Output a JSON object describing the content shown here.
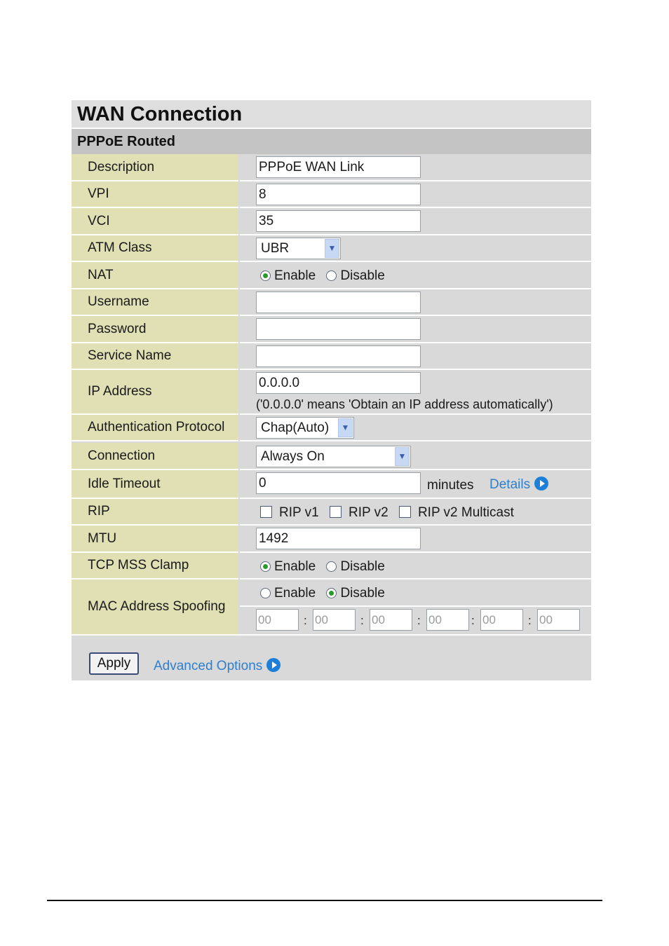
{
  "title": "WAN Connection",
  "subtitle": "PPPoE Routed",
  "fields": {
    "description": {
      "label": "Description",
      "value": "PPPoE WAN Link"
    },
    "vpi": {
      "label": "VPI",
      "value": "8"
    },
    "vci": {
      "label": "VCI",
      "value": "35"
    },
    "atm_class": {
      "label": "ATM Class",
      "selected": "UBR"
    },
    "nat": {
      "label": "NAT",
      "enable": "Enable",
      "disable": "Disable",
      "selected": "Enable"
    },
    "username": {
      "label": "Username",
      "value": ""
    },
    "password": {
      "label": "Password",
      "value": ""
    },
    "service_name": {
      "label": "Service Name",
      "value": ""
    },
    "ip_address": {
      "label": "IP Address",
      "value": "0.0.0.0",
      "note": "('0.0.0.0' means 'Obtain an IP address automatically')"
    },
    "auth_protocol": {
      "label": "Authentication Protocol",
      "selected": "Chap(Auto)"
    },
    "connection": {
      "label": "Connection",
      "selected": "Always On"
    },
    "idle_timeout": {
      "label": "Idle Timeout",
      "value": "0",
      "unit": "minutes",
      "details_link": "Details"
    },
    "rip": {
      "label": "RIP",
      "v1": "RIP v1",
      "v2": "RIP v2",
      "v2_multicast": "RIP v2 Multicast"
    },
    "mtu": {
      "label": "MTU",
      "value": "1492"
    },
    "tcp_mss_clamp": {
      "label": "TCP MSS Clamp",
      "enable": "Enable",
      "disable": "Disable",
      "selected": "Enable"
    },
    "mac_spoofing": {
      "label": "MAC Address Spoofing",
      "enable": "Enable",
      "disable": "Disable",
      "selected": "Disable",
      "octets": [
        "00",
        "00",
        "00",
        "00",
        "00",
        "00"
      ],
      "separator": ":"
    }
  },
  "actions": {
    "apply": "Apply",
    "advanced_options": "Advanced Options"
  },
  "icons": {
    "select_arrow": "chevron-down-icon",
    "link_arrow": "circle-arrow-right-icon"
  },
  "colors": {
    "label_bg": "#e0e0b4",
    "value_bg": "#d9d9d9",
    "link": "#2f7fcc",
    "radio_on": "#2a9a2a"
  }
}
